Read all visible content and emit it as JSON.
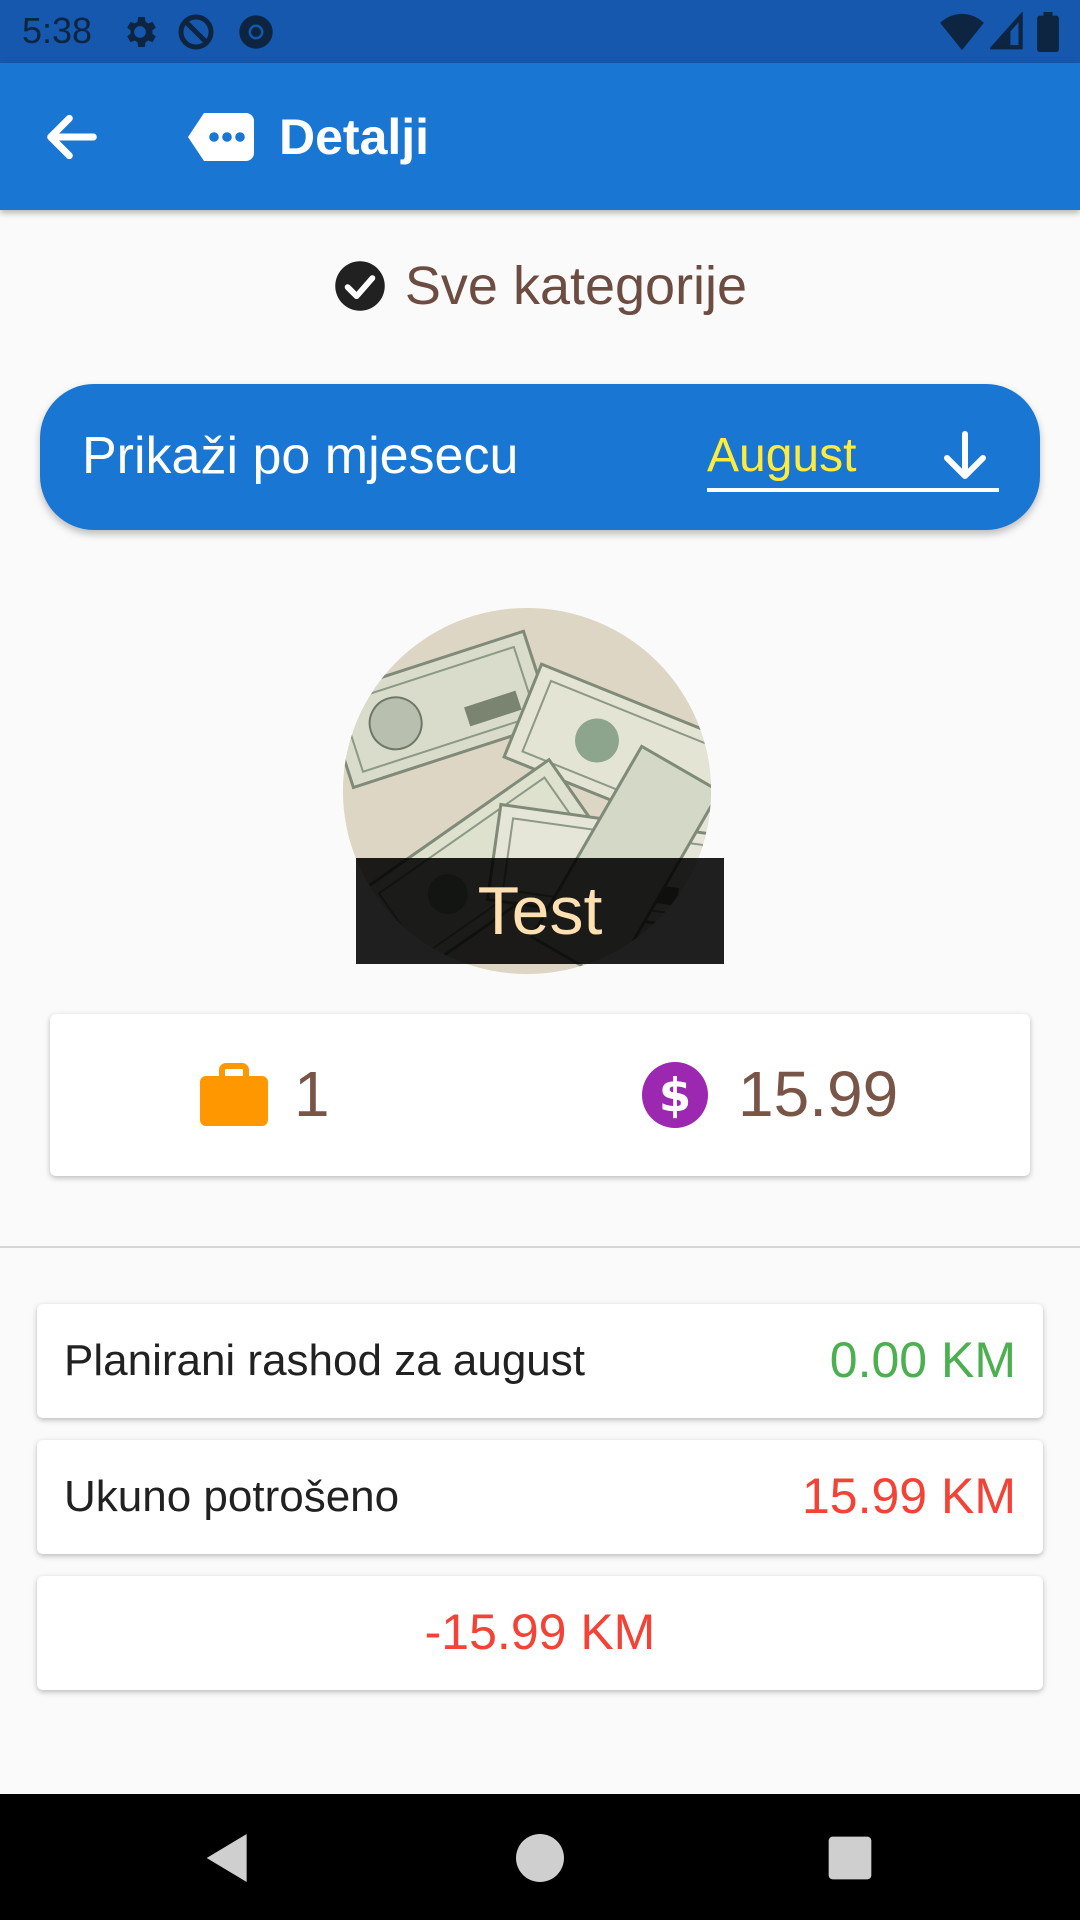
{
  "status_bar": {
    "time": "5:38",
    "icons_left": [
      "gear-icon",
      "at-sign-icon",
      "chrome-icon"
    ],
    "icons_right": [
      "wifi-icon",
      "signal-icon",
      "battery-icon"
    ]
  },
  "app_bar": {
    "title": "Detalji",
    "back_icon": "arrow-left-icon",
    "title_icon": "message-dots-icon"
  },
  "category": {
    "label": "Sve kategorije",
    "icon": "check-circle-icon"
  },
  "month_filter": {
    "label": "Prikaži po mjesecu",
    "selected": "August",
    "arrow_icon": "arrow-down-icon"
  },
  "category_image": {
    "caption": "Test"
  },
  "stats": {
    "count": "1",
    "count_icon": "briefcase-icon",
    "amount": "15.99",
    "amount_icon": "dollar-circle-icon"
  },
  "summary": {
    "planned_label": "Planirani rashod za august",
    "planned_value": "0.00 KM",
    "spent_label": "Ukuno potrošeno",
    "spent_value": "15.99 KM",
    "balance_value": "-15.99 KM"
  },
  "colors": {
    "primary": "#1976d2",
    "status_bar": "#1558ad",
    "accent_yellow": "#ffeb3b",
    "positive": "#4caf50",
    "negative": "#f44336",
    "text_brown": "#795548",
    "briefcase_orange": "#ff9800",
    "dollar_purple": "#9c27b0"
  },
  "nav_bar": {
    "buttons": [
      "back-triangle-icon",
      "home-circle-icon",
      "recents-square-icon"
    ]
  }
}
